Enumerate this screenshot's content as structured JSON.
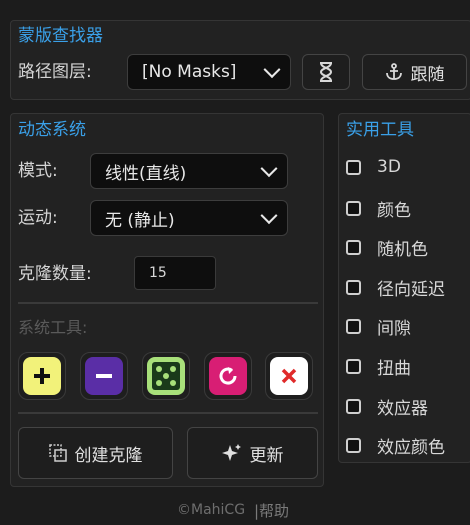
{
  "mask_finder": {
    "title": "蒙版查找器",
    "path_layer_label": "路径图层:",
    "path_layer_value": "[No Masks]",
    "hourglass_icon": "hourglass-icon",
    "follow_button": "跟随"
  },
  "dynamics": {
    "title": "动态系统",
    "mode_label": "模式:",
    "mode_value": "线性(直线)",
    "motion_label": "运动:",
    "motion_value": "无 (静止)",
    "clone_count_label": "克隆数量:",
    "clone_count_value": "15",
    "system_tools_label": "系统工具:",
    "tools": [
      {
        "name": "add",
        "color": "#f2f27a"
      },
      {
        "name": "remove",
        "color": "#5a2ea6"
      },
      {
        "name": "random",
        "color": "#a8e07a"
      },
      {
        "name": "reset",
        "color": "#d81e74"
      },
      {
        "name": "delete",
        "color": "#ffffff"
      }
    ],
    "create_clones_button": "创建克隆",
    "update_button": "更新"
  },
  "utilities": {
    "title": "实用工具",
    "items": [
      "3D",
      "颜色",
      "随机色",
      "径向延迟",
      "间隙",
      "扭曲",
      "效应器",
      "效应颜色"
    ]
  },
  "footer": {
    "copyright": "©MahiCG",
    "help": "|帮助"
  },
  "colors": {
    "accent": "#3aa0e8",
    "background": "#1c1c1c"
  }
}
